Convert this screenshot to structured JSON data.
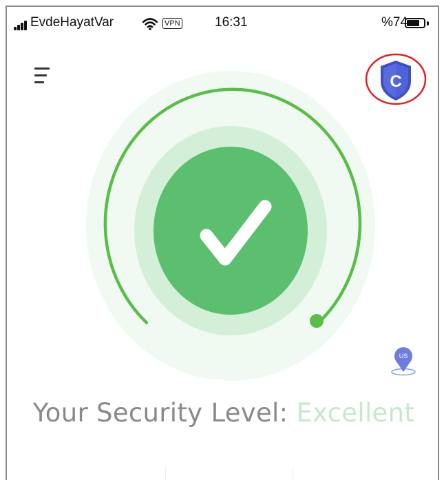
{
  "status_bar": {
    "carrier": "EvdeHayatVar",
    "vpn_label": "VPN",
    "time": "16:31",
    "battery_percent": "%74",
    "battery_level": 0.74
  },
  "header": {
    "menu_icon": "hamburger-menu-icon",
    "shield_icon": "comodo-shield-icon",
    "shield_letter": "C"
  },
  "gauge": {
    "status_icon": "checkmark-icon"
  },
  "location": {
    "country_code": "US"
  },
  "security": {
    "label": "Your Security Level",
    "separator": ":",
    "value": "Excellent"
  },
  "colors": {
    "accent_green": "#5cbf6f",
    "arc_green": "#5bbd49",
    "shield_blue": "#4f5fd6",
    "highlight_red": "#e02020"
  }
}
